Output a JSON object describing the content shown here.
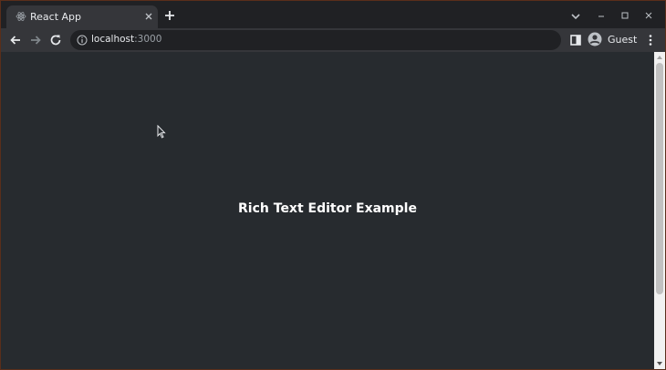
{
  "browser": {
    "tab": {
      "title": "React App",
      "favicon": "react-icon"
    },
    "new_tab_icon": "plus-icon",
    "window_controls": [
      "chevron-down-icon",
      "minimize-icon",
      "maximize-icon",
      "close-icon"
    ],
    "toolbar": {
      "back_icon": "arrow-left-icon",
      "forward_icon": "arrow-right-icon",
      "reload_icon": "reload-icon",
      "address": {
        "host": "localhost",
        "port": ":3000",
        "icon": "info-icon"
      },
      "side_panel_icon": "side-panel-icon",
      "profile": {
        "name": "Guest",
        "icon": "account-circle-icon"
      },
      "menu_icon": "kebab-menu-icon"
    }
  },
  "page": {
    "heading": "Rich Text Editor Example",
    "background": "#272b2f",
    "text_color": "#ffffff"
  },
  "colors": {
    "titlebar": "#202124",
    "toolbar": "#35363a",
    "omnibox": "#202124",
    "window_border": "#5a2e1a"
  }
}
